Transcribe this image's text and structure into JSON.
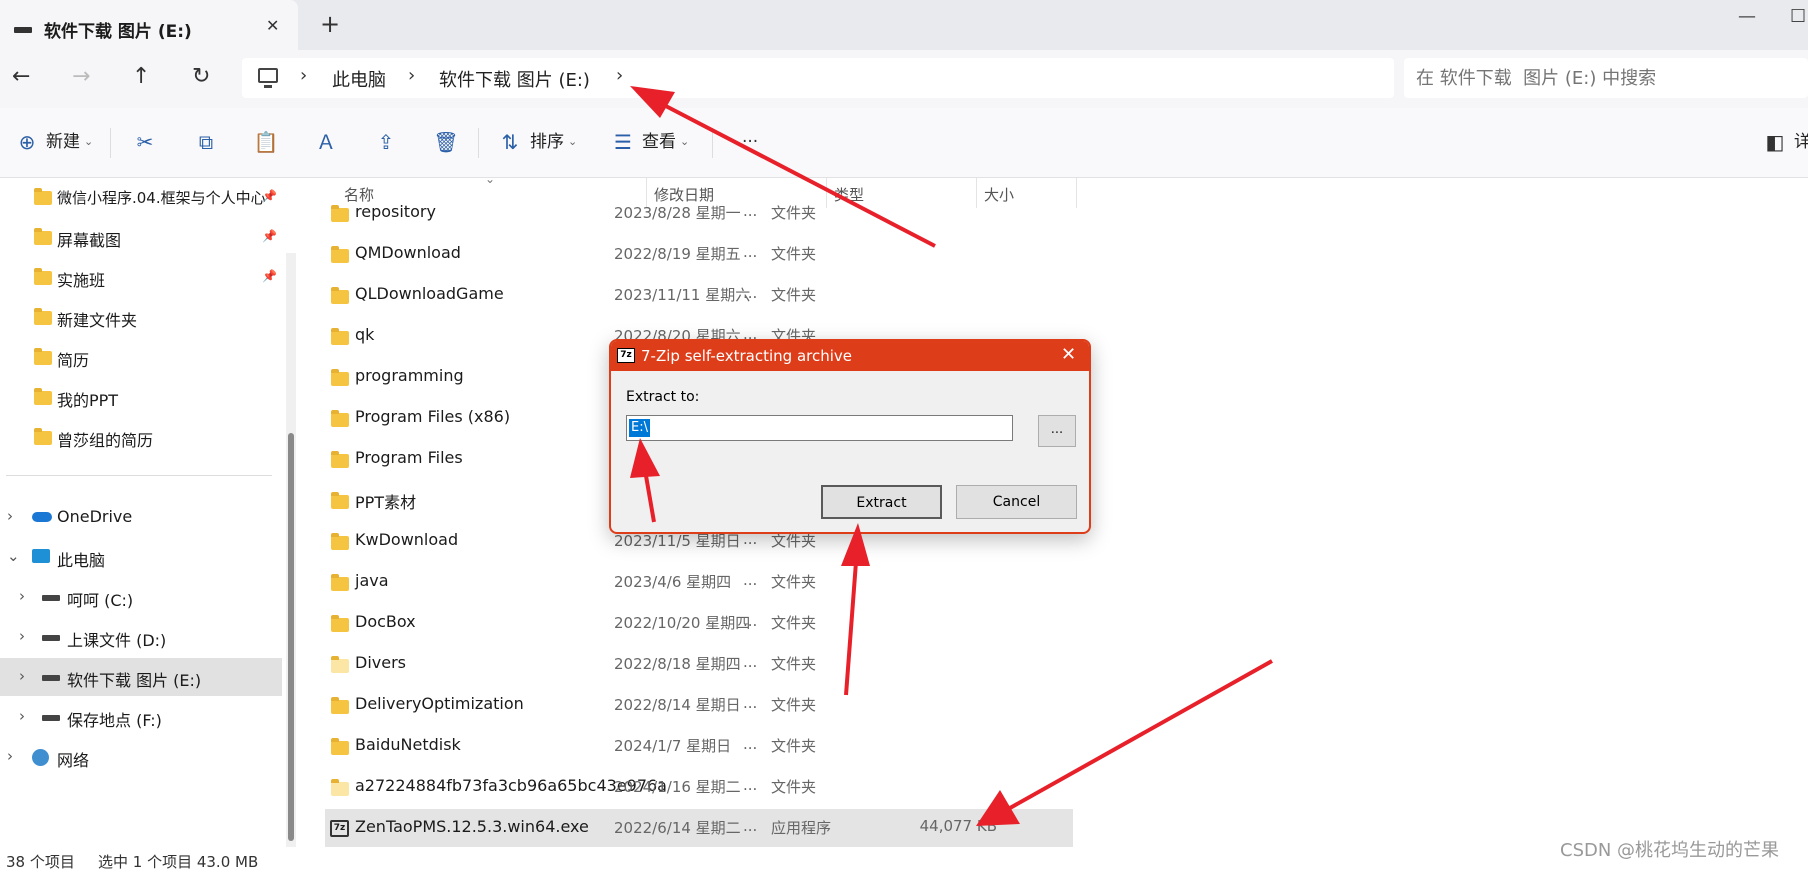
{
  "tab": {
    "title": "软件下载  图片 (E:)",
    "close": "✕",
    "new": "+"
  },
  "window_controls": {
    "minimize": "—",
    "maximize": "☐"
  },
  "nav": {
    "back": "←",
    "forward": "→",
    "up": "↑",
    "refresh": "↻"
  },
  "breadcrumb": [
    "此电脑",
    "软件下载  图片 (E:)"
  ],
  "breadcrumb_sep": "›",
  "search": {
    "placeholder": "在 软件下载  图片 (E:) 中搜索"
  },
  "toolbar": {
    "new_label": "新建",
    "sort_label": "排序",
    "view_label": "查看",
    "more": "···",
    "details_label": "详"
  },
  "sidebar": {
    "quick": [
      {
        "label": "微信小程序.04.框架与个人中心",
        "pinned": true
      },
      {
        "label": "屏幕截图",
        "pinned": true
      },
      {
        "label": "实施班",
        "pinned": true
      },
      {
        "label": "新建文件夹",
        "pinned": false
      },
      {
        "label": "简历",
        "pinned": false
      },
      {
        "label": "我的PPT",
        "pinned": false
      },
      {
        "label": "曾莎组的简历",
        "pinned": false
      }
    ],
    "onedrive": "OneDrive",
    "thispc": "此电脑",
    "drives": [
      "呵呵 (C:)",
      "上课文件 (D:)",
      "软件下载  图片 (E:)",
      "保存地点 (F:)"
    ],
    "network": "网络"
  },
  "columns": {
    "name": "名称",
    "modified": "修改日期",
    "type": "类型",
    "size": "大小"
  },
  "files": [
    {
      "name": "repository",
      "date": "2023/8/28 星期一",
      "dots": "...",
      "type": "文件夹",
      "size": ""
    },
    {
      "name": "QMDownload",
      "date": "2022/8/19 星期五",
      "dots": "...",
      "type": "文件夹",
      "size": ""
    },
    {
      "name": "QLDownloadGame",
      "date": "2023/11/11 星期六",
      "dots": "...",
      "type": "文件夹",
      "size": ""
    },
    {
      "name": "qk",
      "date": "2022/8/20 星期六",
      "dots": "...",
      "type": "文件夹",
      "size": ""
    },
    {
      "name": "programming",
      "date": "",
      "dots": "",
      "type": "",
      "size": ""
    },
    {
      "name": "Program Files (x86)",
      "date": "",
      "dots": "",
      "type": "",
      "size": ""
    },
    {
      "name": "Program Files",
      "date": "",
      "dots": "",
      "type": "",
      "size": ""
    },
    {
      "name": "PPT素材",
      "date": "",
      "dots": "",
      "type": "",
      "size": ""
    },
    {
      "name": "KwDownload",
      "date": "2023/11/5 星期日",
      "dots": "...",
      "type": "文件夹",
      "size": ""
    },
    {
      "name": "java",
      "date": "2023/4/6 星期四",
      "dots": "...",
      "type": "文件夹",
      "size": ""
    },
    {
      "name": "DocBox",
      "date": "2022/10/20 星期四",
      "dots": "...",
      "type": "文件夹",
      "size": ""
    },
    {
      "name": "Divers",
      "date": "2022/8/18 星期四",
      "dots": "...",
      "type": "文件夹",
      "size": ""
    },
    {
      "name": "DeliveryOptimization",
      "date": "2022/8/14 星期日",
      "dots": "...",
      "type": "文件夹",
      "size": ""
    },
    {
      "name": "BaiduNetdisk",
      "date": "2024/1/7 星期日",
      "dots": "...",
      "type": "文件夹",
      "size": ""
    },
    {
      "name": "a27224884fb73fa3cb96a65bc43e976a",
      "date": "2024/1/16 星期二",
      "dots": "...",
      "type": "文件夹",
      "size": ""
    },
    {
      "name": "ZenTaoPMS.12.5.3.win64.exe",
      "date": "2022/6/14 星期二",
      "dots": "...",
      "type": "应用程序",
      "size": "44,077 KB"
    }
  ],
  "status": {
    "count": "38 个项目",
    "selected": "选中 1 个项目  43.0 MB"
  },
  "watermark": "CSDN @桃花坞生动的芒果",
  "dialog": {
    "icon_text": "7z",
    "title": "7-Zip self-extracting archive",
    "close": "✕",
    "label": "Extract to:",
    "path": "E:\\",
    "browse": "...",
    "extract": "Extract",
    "cancel": "Cancel"
  },
  "colors": {
    "dialog_accent": "#de3d1a",
    "annotation": "#e8202a",
    "folder": "#f5c542"
  }
}
